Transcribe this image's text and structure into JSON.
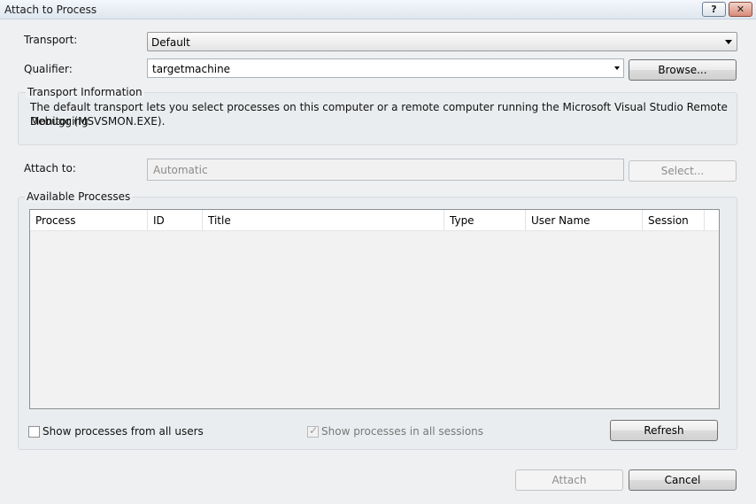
{
  "window": {
    "title": "Attach to Process",
    "help_label": "?",
    "close_label": "✕"
  },
  "transport": {
    "label": "Transport:",
    "value": "Default"
  },
  "qualifier": {
    "label": "Qualifier:",
    "value": "targetmachine",
    "browse_label": "Browse..."
  },
  "transport_info": {
    "label": "Transport Information",
    "text_line1": "The default transport lets you select processes on this computer or a remote computer running the Microsoft Visual Studio Remote Debugging",
    "text_line2": "Monitor (MSVSMON.EXE)."
  },
  "attach_to": {
    "label": "Attach to:",
    "value": "Automatic",
    "select_label": "Select..."
  },
  "processes": {
    "label": "Available Processes",
    "columns": [
      "Process",
      "ID",
      "Title",
      "Type",
      "User Name",
      "Session"
    ]
  },
  "options": {
    "all_users_label": "Show processes from all users",
    "all_users_checked": false,
    "all_sessions_label": "Show processes in all sessions",
    "all_sessions_checked": true,
    "refresh_label": "Refresh"
  },
  "footer": {
    "attach_label": "Attach",
    "cancel_label": "Cancel"
  }
}
